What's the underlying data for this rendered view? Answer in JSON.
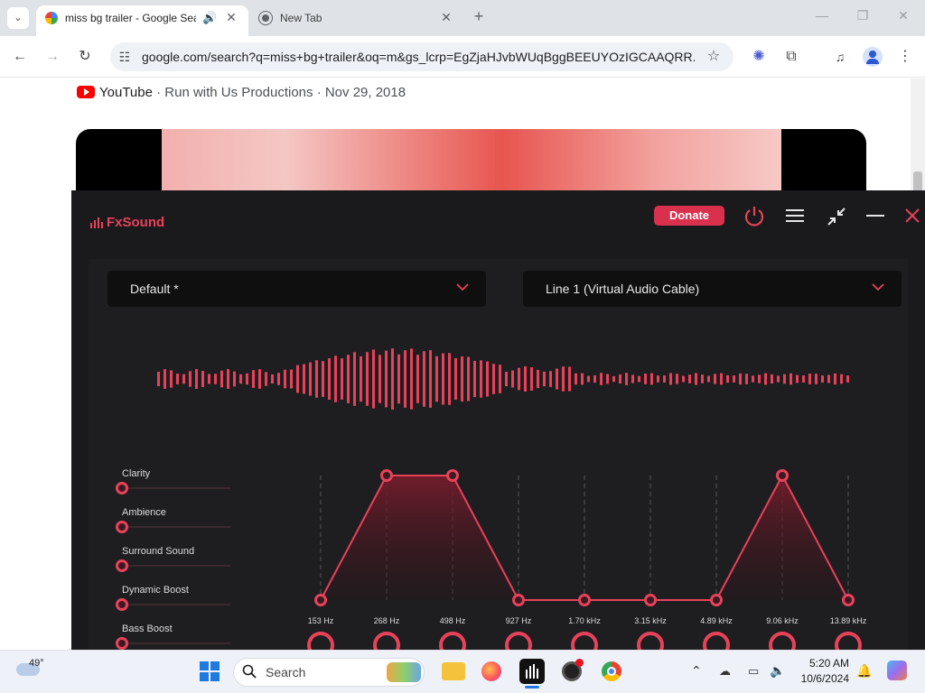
{
  "browser": {
    "tabs": [
      {
        "title": "miss bg trailer - Google Search"
      },
      {
        "title": "New Tab"
      }
    ],
    "url": "google.com/search?q=miss+bg+trailer&oq=m&gs_lcrp=EgZjaHJvbWUqBggBEEUYOzIGCAAQRR..."
  },
  "result": {
    "source": "YouTube",
    "meta": " · Run with Us Productions · Nov 29, 2018"
  },
  "fxsound": {
    "brand": "FxSound",
    "donate_label": "Donate",
    "preset": "Default *",
    "output_device": "Line 1 (Virtual Audio Cable)",
    "effects": [
      {
        "label": "Clarity",
        "value": 0
      },
      {
        "label": "Ambience",
        "value": 0
      },
      {
        "label": "Surround Sound",
        "value": 0
      },
      {
        "label": "Dynamic Boost",
        "value": 0
      },
      {
        "label": "Bass Boost",
        "value": 0
      }
    ],
    "eq_bands": [
      {
        "freq": "153 Hz",
        "level": 0.0
      },
      {
        "freq": "268 Hz",
        "level": 1.0
      },
      {
        "freq": "498 Hz",
        "level": 1.0
      },
      {
        "freq": "927 Hz",
        "level": 0.0
      },
      {
        "freq": "1.70 kHz",
        "level": 0.0
      },
      {
        "freq": "3.15 kHz",
        "level": 0.0
      },
      {
        "freq": "4.89 kHz",
        "level": 0.0
      },
      {
        "freq": "9.06 kHz",
        "level": 1.0
      },
      {
        "freq": "13.89 kHz",
        "level": 0.0
      }
    ],
    "colors": {
      "accent": "#e8425a",
      "background": "#1a1a1c"
    }
  },
  "taskbar": {
    "weather": "49°",
    "search_placeholder": "Search",
    "time": "5:20 AM",
    "date": "10/6/2024"
  }
}
